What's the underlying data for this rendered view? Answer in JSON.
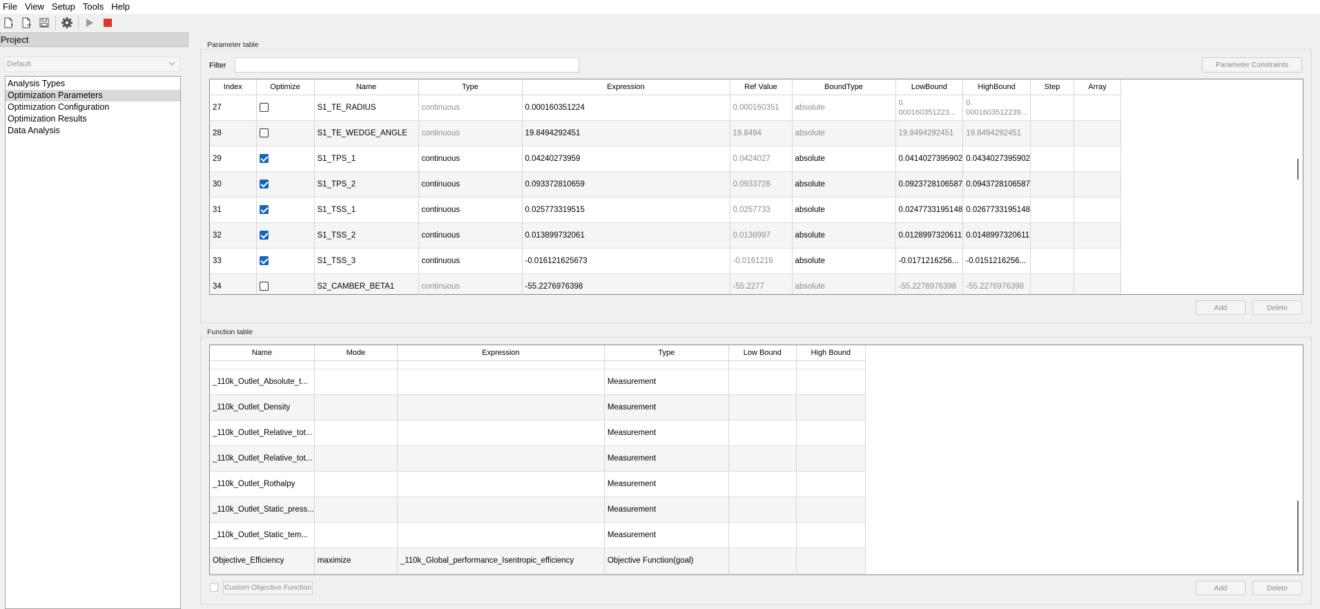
{
  "menu": [
    "File",
    "View",
    "Setup",
    "Tools",
    "Help"
  ],
  "toolbar": {
    "icons": [
      "new-file-icon",
      "import-file-icon",
      "save-icon",
      "settings-gear-icon",
      "run-play-icon",
      "stop-icon"
    ]
  },
  "left_panel": {
    "title": "Project",
    "project_combo": "Default",
    "nav_items": [
      {
        "label": "Analysis Types",
        "selected": false
      },
      {
        "label": "Optimization Parameters",
        "selected": true
      },
      {
        "label": "Optimization Configuration",
        "selected": false
      },
      {
        "label": "Optimization Results",
        "selected": false
      },
      {
        "label": "Data Analysis",
        "selected": false
      }
    ]
  },
  "parameter_table": {
    "title": "Parameter table",
    "filter_label": "Filter",
    "filter_value": "",
    "constraints_button": "Parameter Constraints",
    "add_button": "Add",
    "delete_button": "Delete",
    "columns": [
      "Index",
      "Optimize",
      "Name",
      "Type",
      "Expression",
      "Ref Value",
      "BoundType",
      "LowBound",
      "HighBound",
      "Step",
      "Array"
    ],
    "rows": [
      {
        "index": "27",
        "optimize": false,
        "name": "S1_TE_RADIUS",
        "type": "continuous",
        "expression": "0.000160351224",
        "ref": "0.000160351",
        "bound_type": "absolute",
        "low": "0.\n000160351223...",
        "high": "0.\n0001603512239..."
      },
      {
        "index": "28",
        "optimize": false,
        "name": "S1_TE_WEDGE_ANGLE",
        "type": "continuous",
        "expression": "19.8494292451",
        "ref": "19.8494",
        "bound_type": "absolute",
        "low": "19.8494292451",
        "high": "19.8494292451"
      },
      {
        "index": "29",
        "optimize": true,
        "name": "S1_TPS_1",
        "type": "continuous",
        "expression": "0.04240273959",
        "ref": "0.0424027",
        "bound_type": "absolute",
        "low": "0.0414027395902",
        "high": "0.0434027395902"
      },
      {
        "index": "30",
        "optimize": true,
        "name": "S1_TPS_2",
        "type": "continuous",
        "expression": "0.093372810659",
        "ref": "0.0933728",
        "bound_type": "absolute",
        "low": "0.0923728106587",
        "high": "0.0943728106587"
      },
      {
        "index": "31",
        "optimize": true,
        "name": "S1_TSS_1",
        "type": "continuous",
        "expression": "0.025773319515",
        "ref": "0.0257733",
        "bound_type": "absolute",
        "low": "0.0247733195148",
        "high": "0.0267733195148"
      },
      {
        "index": "32",
        "optimize": true,
        "name": "S1_TSS_2",
        "type": "continuous",
        "expression": "0.013899732061",
        "ref": "0.0138997",
        "bound_type": "absolute",
        "low": "0.0128997320611",
        "high": "0.0148997320611"
      },
      {
        "index": "33",
        "optimize": true,
        "name": "S1_TSS_3",
        "type": "continuous",
        "expression": "-0.016121625673",
        "ref": "-0.0161216",
        "bound_type": "absolute",
        "low": "-0.0171216256...",
        "high": "-0.0151216256..."
      },
      {
        "index": "34",
        "optimize": false,
        "name": "S2_CAMBER_BETA1",
        "type": "continuous",
        "expression": "-55.2276976398",
        "ref": "-55.2277",
        "bound_type": "absolute",
        "low": "-55.2276976398",
        "high": "-55.2276976398"
      }
    ]
  },
  "function_table": {
    "title": "Function table",
    "columns": [
      "Name",
      "Mode",
      "Expression",
      "Type",
      "Low Bound",
      "High Bound"
    ],
    "custom_objective_label": "Custom Objective Function",
    "add_button": "Add",
    "delete_button": "Delete",
    "rows": [
      {
        "name": "_110k_Outlet_Absolute_t...",
        "mode": "",
        "expression": "",
        "type": "Measurement",
        "low": "",
        "high": ""
      },
      {
        "name": "_110k_Outlet_Density",
        "mode": "",
        "expression": "",
        "type": "Measurement",
        "low": "",
        "high": ""
      },
      {
        "name": "_110k_Outlet_Relative_tot...",
        "mode": "",
        "expression": "",
        "type": "Measurement",
        "low": "",
        "high": ""
      },
      {
        "name": "_110k_Outlet_Relative_tot...",
        "mode": "",
        "expression": "",
        "type": "Measurement",
        "low": "",
        "high": ""
      },
      {
        "name": "_110k_Outlet_Rothalpy",
        "mode": "",
        "expression": "",
        "type": "Measurement",
        "low": "",
        "high": ""
      },
      {
        "name": "_110k_Outlet_Static_press...",
        "mode": "",
        "expression": "",
        "type": "Measurement",
        "low": "",
        "high": ""
      },
      {
        "name": "_110k_Outlet_Static_tem...",
        "mode": "",
        "expression": "",
        "type": "Measurement",
        "low": "",
        "high": ""
      },
      {
        "name": "Objective_Efficiency",
        "mode": "maximize",
        "expression": "_110k_Global_performance_Isentropic_efficiency",
        "type": "Objective Function(goal)",
        "low": "",
        "high": ""
      }
    ]
  }
}
